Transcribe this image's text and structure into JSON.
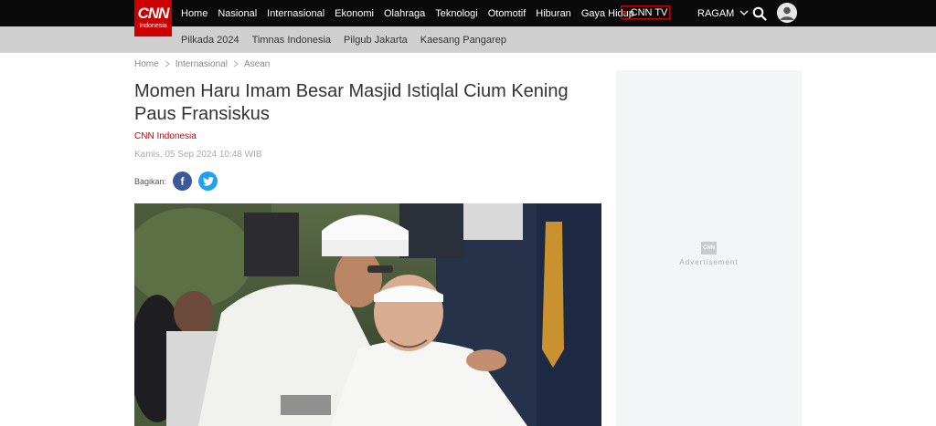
{
  "header": {
    "logo_text": "CNN",
    "logo_sub": "Indonesia",
    "nav": [
      "Home",
      "Nasional",
      "Internasional",
      "Ekonomi",
      "Olahraga",
      "Teknologi",
      "Otomotif",
      "Hiburan",
      "Gaya Hidup"
    ],
    "cnntv_label": "CNN TV",
    "ragam_label": "RAGAM"
  },
  "subnav": [
    "Pilkada 2024",
    "Timnas Indonesia",
    "Pilgub Jakarta",
    "Kaesang Pangarep"
  ],
  "breadcrumb": [
    "Home",
    "Internasional",
    "Asean"
  ],
  "article": {
    "title": "Momen Haru Imam Besar Masjid Istiqlal Cium Kening Paus Fransiskus",
    "source": "CNN Indonesia",
    "date": "Kamis, 05 Sep 2024 10:48 WIB",
    "share_label": "Bagikan:"
  },
  "ad": {
    "logo": "CNN",
    "label": "Advertisement"
  },
  "colors": {
    "brand": "#cc0000",
    "facebook": "#3b5998",
    "twitter": "#1da1f2"
  }
}
